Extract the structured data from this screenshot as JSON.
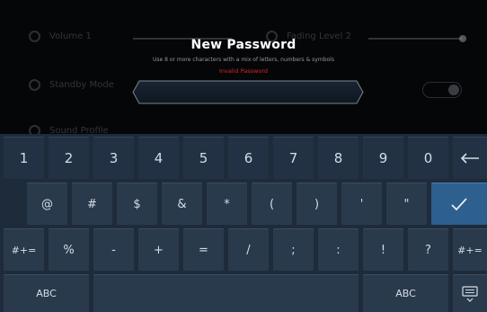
{
  "background": {
    "items": [
      {
        "label": "Volume 1",
        "icon": "volume-icon"
      },
      {
        "label": "Fading Level 2",
        "icon": "fading-icon"
      },
      {
        "label": "Standby Mode",
        "icon": "standby-icon"
      },
      {
        "label": "Sound Profile",
        "icon": "profile-icon"
      }
    ]
  },
  "dialog": {
    "title": "New Password",
    "hint": "Use 8 or more characters with a mix of letters, numbers & symbols",
    "error": "Invalid Password",
    "input_value": ""
  },
  "keyboard": {
    "rows": [
      [
        "1",
        "2",
        "3",
        "4",
        "5",
        "6",
        "7",
        "8",
        "9",
        "0"
      ],
      [
        "@",
        "#",
        "$",
        "&",
        "*",
        "(",
        ")",
        "'",
        "\""
      ],
      [
        "#+=",
        "%",
        "-",
        "+",
        "=",
        "/",
        ";",
        ":",
        "!",
        "?",
        "#+="
      ],
      [
        "ABC",
        "ABC"
      ]
    ],
    "backspace_icon": "backspace-icon",
    "enter_icon": "checkmark-icon",
    "hide_icon": "keyboard-hide-icon"
  },
  "colors": {
    "keyboard_bg": "#1e2b3b",
    "key_bg": "#2a3a4d",
    "enter_bg": "#2d5f8f",
    "error": "#d8262b",
    "accent": "#4a7fb0"
  }
}
